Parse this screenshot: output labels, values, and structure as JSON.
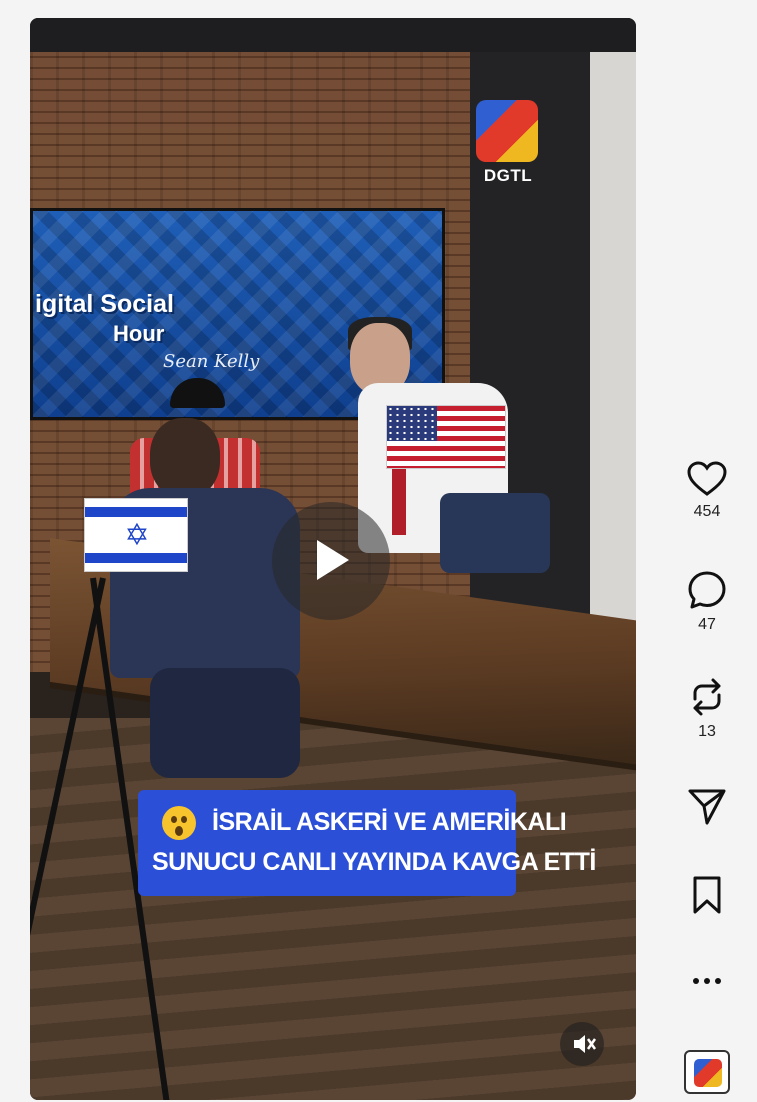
{
  "video": {
    "brand_logo": {
      "text": "DGTL",
      "icon": "dgtl-logo"
    },
    "screen": {
      "title": "igital Social",
      "subtitle": "Hour",
      "signature": "Sean Kelly"
    },
    "flags": {
      "left": "israel-flag",
      "right": "usa-flag"
    },
    "play_icon": "play-icon",
    "caption": {
      "emoji": "astonished-face-emoji",
      "line1": "İSRAİL ASKERİ VE AMERİKALI",
      "line2": "SUNUCU CANLI YAYINDA KAVGA ETTİ"
    },
    "mute_icon": "speaker-muted-icon"
  },
  "actions": {
    "like": {
      "icon": "heart-icon",
      "count": "454"
    },
    "comment": {
      "icon": "comment-bubble-icon",
      "count": "47"
    },
    "repost": {
      "icon": "repost-icon",
      "count": "13"
    },
    "share": {
      "icon": "send-icon"
    },
    "save": {
      "icon": "bookmark-icon"
    },
    "more": {
      "icon": "more-dots-icon"
    }
  },
  "account_badge": {
    "icon": "dgtl-avatar-icon"
  },
  "colors": {
    "caption_bg": "#2c4fd8",
    "background": "#f4f4f4"
  }
}
